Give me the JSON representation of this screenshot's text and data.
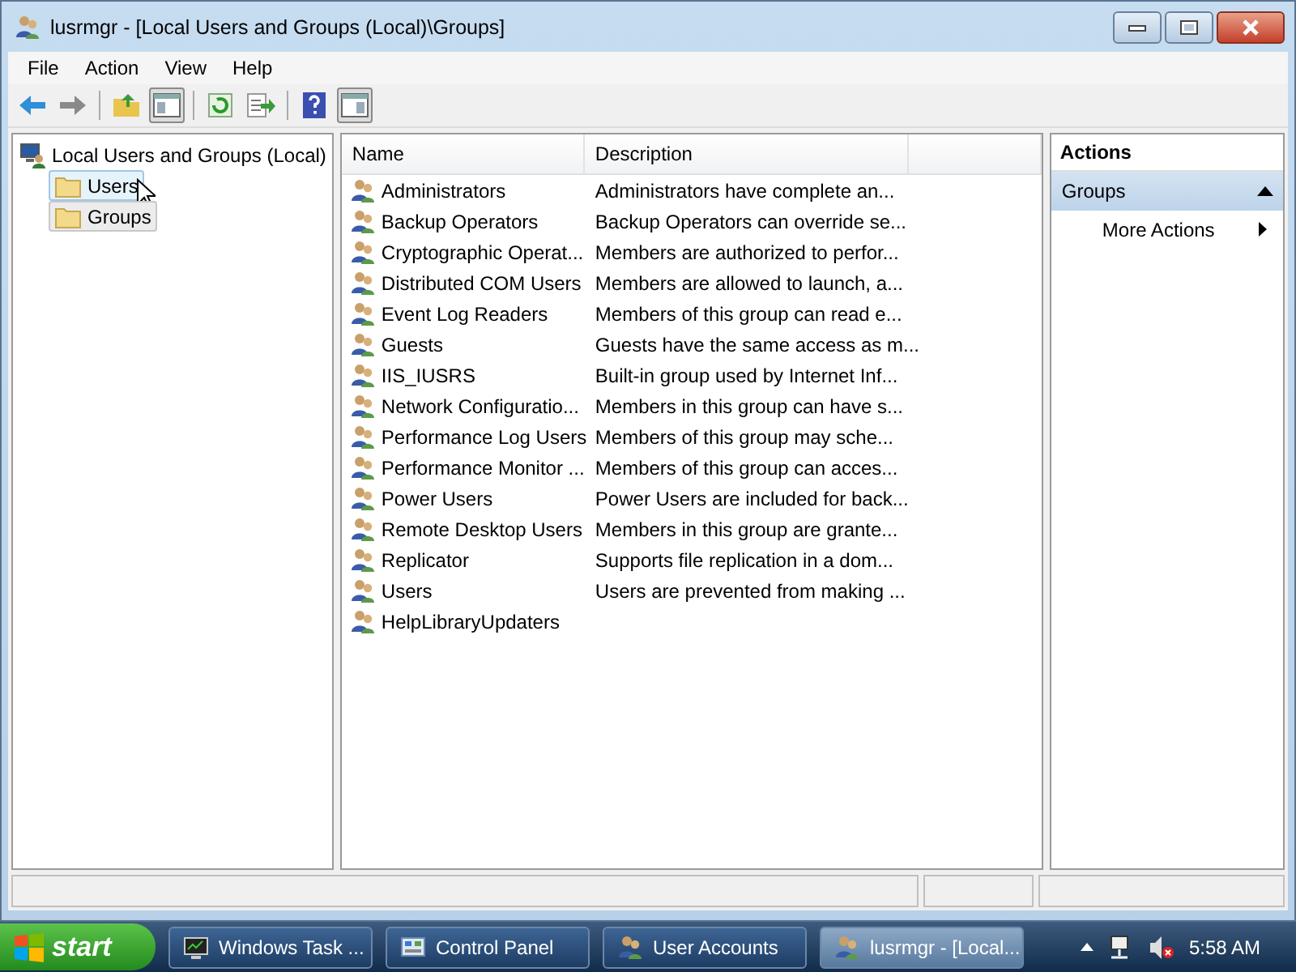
{
  "window": {
    "title": "lusrmgr - [Local Users and Groups (Local)\\Groups]"
  },
  "menu": [
    "File",
    "Action",
    "View",
    "Help"
  ],
  "toolbar": [
    {
      "kind": "back",
      "pressed": false
    },
    {
      "kind": "forward",
      "pressed": false
    },
    {
      "kind": "sep"
    },
    {
      "kind": "up",
      "pressed": false
    },
    {
      "kind": "tree",
      "pressed": true
    },
    {
      "kind": "sep"
    },
    {
      "kind": "refresh",
      "pressed": false
    },
    {
      "kind": "export",
      "pressed": false
    },
    {
      "kind": "sep"
    },
    {
      "kind": "help",
      "pressed": false
    },
    {
      "kind": "actionpane",
      "pressed": true
    }
  ],
  "tree": {
    "label": "Local Users and Groups (Local)",
    "children": [
      {
        "label": "Users",
        "selected": false,
        "hovered": true
      },
      {
        "label": "Groups",
        "selected": true,
        "hovered": false
      }
    ]
  },
  "table": {
    "columns": [
      "Name",
      "Description"
    ],
    "rows": [
      {
        "name": "Administrators",
        "description": "Administrators have complete an..."
      },
      {
        "name": "Backup Operators",
        "description": "Backup Operators can override se..."
      },
      {
        "name": "Cryptographic Operat...",
        "description": "Members are authorized to perfor..."
      },
      {
        "name": "Distributed COM Users",
        "description": "Members are allowed to launch, a..."
      },
      {
        "name": "Event Log Readers",
        "description": "Members of this group can read e..."
      },
      {
        "name": "Guests",
        "description": "Guests have the same access as m..."
      },
      {
        "name": "IIS_IUSRS",
        "description": "Built-in group used by Internet Inf..."
      },
      {
        "name": "Network Configuratio...",
        "description": "Members in this group can have s..."
      },
      {
        "name": "Performance Log Users",
        "description": "Members of this group may sche..."
      },
      {
        "name": "Performance Monitor ...",
        "description": "Members of this group can acces..."
      },
      {
        "name": "Power Users",
        "description": "Power Users are included for back..."
      },
      {
        "name": "Remote Desktop Users",
        "description": "Members in this group are grante..."
      },
      {
        "name": "Replicator",
        "description": "Supports file replication in a dom..."
      },
      {
        "name": "Users",
        "description": "Users are prevented from making ..."
      },
      {
        "name": "HelpLibraryUpdaters"
      }
    ]
  },
  "actions": {
    "title": "Actions",
    "section": {
      "label": "Groups",
      "expanded": true
    },
    "items": [
      "More Actions"
    ]
  },
  "taskbar": {
    "start": "start",
    "buttons": [
      {
        "label": "Windows Task ...",
        "kind": "monitor",
        "selected": false
      },
      {
        "label": "Control Panel",
        "kind": "panel",
        "selected": false
      },
      {
        "label": "User Accounts",
        "kind": "users",
        "selected": false
      },
      {
        "label": "lusrmgr - [Local...",
        "kind": "mmc",
        "selected": true
      }
    ],
    "clock": "5:58 AM"
  }
}
